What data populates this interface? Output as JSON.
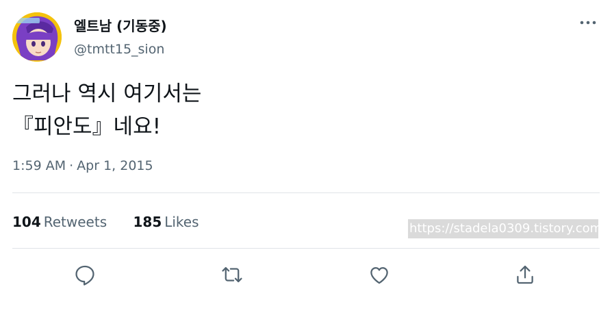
{
  "author": {
    "display_name": "엘트남 (기동중)",
    "handle": "@tmtt15_sion",
    "avatar_icon": "avatar-image"
  },
  "header": {
    "more_icon": "more-horizontal-icon"
  },
  "tweet": {
    "text": "그러나 역시 여기서는\n『피안도』네요!",
    "time": "1:59 AM",
    "separator": "·",
    "date": "Apr 1, 2015"
  },
  "stats": {
    "retweets_count": "104",
    "retweets_label": "Retweets",
    "likes_count": "185",
    "likes_label": "Likes"
  },
  "watermark": {
    "text": "https://stadela0309.tistory.com"
  },
  "actions": [
    {
      "icon": "reply-icon"
    },
    {
      "icon": "retweet-icon"
    },
    {
      "icon": "like-icon"
    },
    {
      "icon": "share-icon"
    }
  ],
  "colors": {
    "text_primary": "#0f1419",
    "text_secondary": "#536471",
    "divider": "#dfe3e7",
    "icon": "#536471"
  }
}
